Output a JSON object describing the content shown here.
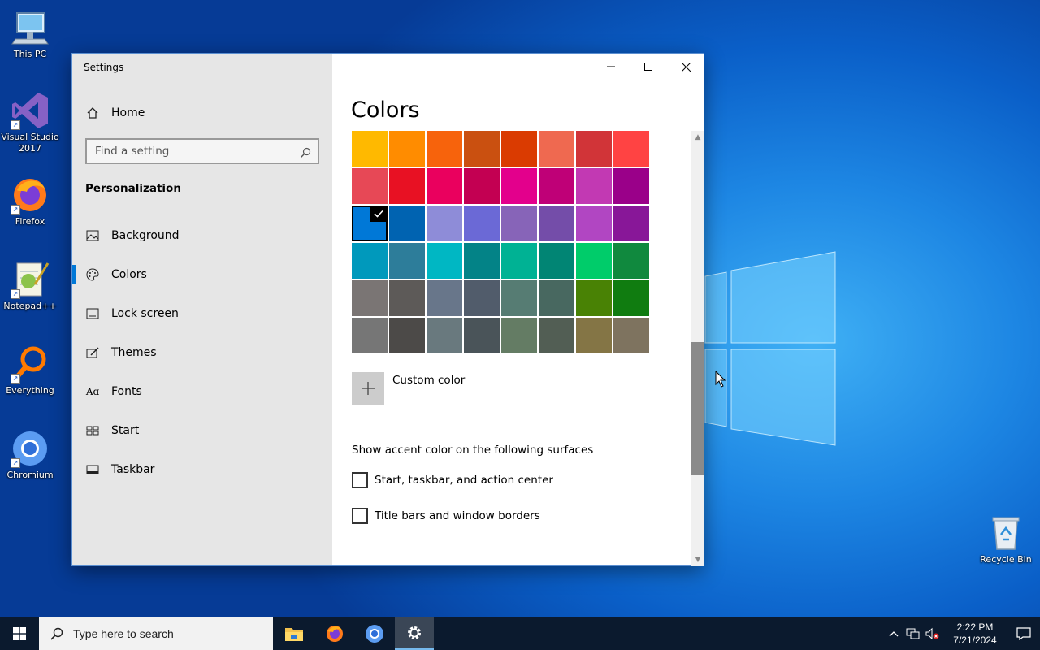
{
  "desktop": {
    "icons": [
      {
        "label": "This PC",
        "icon": "this-pc-icon"
      },
      {
        "label": "Visual Studio 2017",
        "icon": "visual-studio-icon"
      },
      {
        "label": "Firefox",
        "icon": "firefox-icon"
      },
      {
        "label": "Notepad++",
        "icon": "notepad-plus-plus-icon"
      },
      {
        "label": "Everything",
        "icon": "everything-search-icon"
      },
      {
        "label": "Chromium",
        "icon": "chromium-icon"
      }
    ],
    "recycle_bin": {
      "label": "Recycle Bin",
      "icon": "recycle-bin-icon"
    }
  },
  "window": {
    "app_title": "Settings",
    "controls": {
      "minimize": "minimize-icon",
      "maximize": "maximize-icon",
      "close": "close-icon"
    }
  },
  "sidebar": {
    "home_label": "Home",
    "search_placeholder": "Find a setting",
    "section_title": "Personalization",
    "items": [
      {
        "label": "Background",
        "icon": "picture-icon",
        "active": false
      },
      {
        "label": "Colors",
        "icon": "palette-icon",
        "active": true
      },
      {
        "label": "Lock screen",
        "icon": "lock-screen-icon",
        "active": false
      },
      {
        "label": "Themes",
        "icon": "themes-icon",
        "active": false
      },
      {
        "label": "Fonts",
        "icon": "fonts-icon",
        "active": false
      },
      {
        "label": "Start",
        "icon": "start-icon",
        "active": false
      },
      {
        "label": "Taskbar",
        "icon": "taskbar-icon",
        "active": false
      }
    ]
  },
  "main": {
    "title": "Colors",
    "accent_colors": [
      "#FFB900",
      "#FF8C00",
      "#F7630C",
      "#CA5010",
      "#DA3B01",
      "#EF6950",
      "#D13438",
      "#FF4343",
      "#E74856",
      "#E81123",
      "#EA005E",
      "#C30052",
      "#E3008C",
      "#BF0077",
      "#C239B3",
      "#9A0089",
      "#0078D7",
      "#0063B1",
      "#8E8CD8",
      "#6B69D6",
      "#8764B8",
      "#744DA9",
      "#B146C2",
      "#881798",
      "#0099BC",
      "#2D7D9A",
      "#00B7C3",
      "#038387",
      "#00B294",
      "#018574",
      "#00CC6A",
      "#10893E",
      "#7A7574",
      "#5D5A58",
      "#68768A",
      "#515C6B",
      "#567C73",
      "#486860",
      "#498205",
      "#107C10",
      "#767676",
      "#4C4A48",
      "#69797E",
      "#4A5459",
      "#647C64",
      "#525E54",
      "#847545",
      "#7E735F"
    ],
    "selected_index": 16,
    "custom_color_label": "Custom color",
    "accent_surfaces_heading": "Show accent color on the following surfaces",
    "checkboxes": [
      {
        "label": "Start, taskbar, and action center",
        "checked": false
      },
      {
        "label": "Title bars and window borders",
        "checked": false
      }
    ]
  },
  "taskbar": {
    "search_placeholder": "Type here to search",
    "apps": [
      "file-explorer-icon",
      "firefox-icon",
      "chromium-icon",
      "settings-gear-icon"
    ],
    "active_app": "settings-gear-icon",
    "clock_time": "2:22 PM",
    "clock_date": "7/21/2024"
  }
}
